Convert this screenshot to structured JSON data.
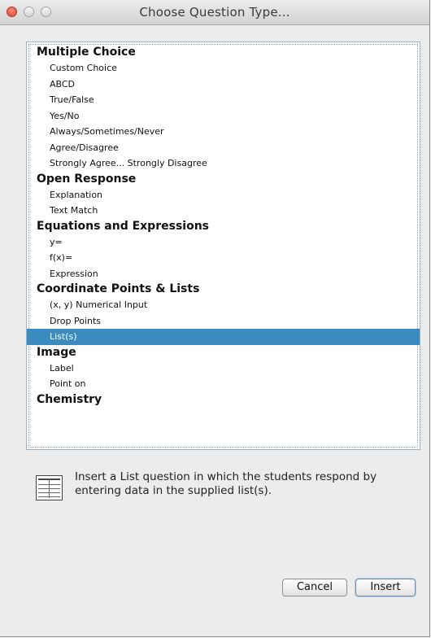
{
  "window": {
    "title": "Choose Question Type..."
  },
  "list": {
    "selected": "List(s)",
    "groups": [
      {
        "label": "Multiple Choice",
        "items": [
          "Custom Choice",
          "ABCD",
          "True/False",
          "Yes/No",
          "Always/Sometimes/Never",
          "Agree/Disagree",
          "Strongly Agree... Strongly Disagree"
        ]
      },
      {
        "label": "Open Response",
        "items": [
          "Explanation",
          "Text Match"
        ]
      },
      {
        "label": "Equations and Expressions",
        "items": [
          "y=",
          "f(x)=",
          "Expression"
        ]
      },
      {
        "label": "Coordinate Points & Lists",
        "items": [
          "(x, y) Numerical Input",
          "Drop Points",
          "List(s)"
        ]
      },
      {
        "label": "Image",
        "items": [
          "Label",
          "Point on"
        ]
      },
      {
        "label": "Chemistry",
        "items": []
      }
    ]
  },
  "description": {
    "icon": "list-table-icon",
    "text": "Insert a List question in which the students respond by entering data in the supplied list(s)."
  },
  "buttons": {
    "cancel_label": "Cancel",
    "insert_label": "Insert"
  },
  "colors": {
    "selection": "#3b8bc0",
    "close_button": "#d8402f"
  }
}
